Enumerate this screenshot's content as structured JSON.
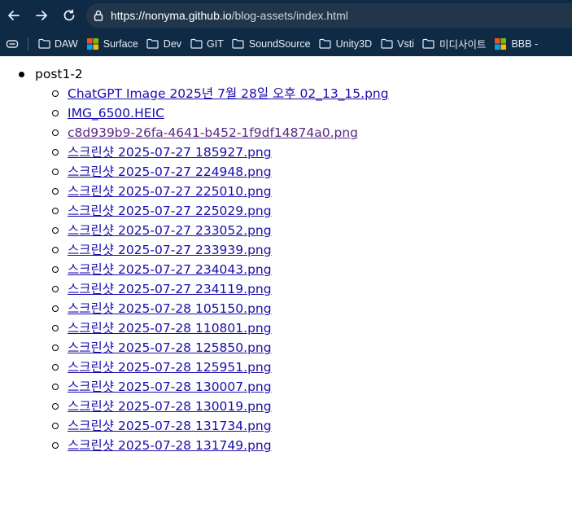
{
  "browser": {
    "url_host": "https://nonyma.github.io",
    "url_path": "/blog-assets/index.html",
    "icons": [
      "back-arrow-icon",
      "forward-arrow-icon",
      "reload-icon",
      "site-info-icon"
    ]
  },
  "bookmarks": [
    {
      "label": "DAW",
      "icon": "folder-icon"
    },
    {
      "label": "Surface",
      "icon": "microsoft-icon"
    },
    {
      "label": "Dev",
      "icon": "folder-icon"
    },
    {
      "label": "GIT",
      "icon": "folder-icon"
    },
    {
      "label": "SoundSource",
      "icon": "folder-icon"
    },
    {
      "label": "Unity3D",
      "icon": "folder-icon"
    },
    {
      "label": "Vsti",
      "icon": "folder-icon"
    },
    {
      "label": "미디사이트",
      "icon": "folder-icon"
    },
    {
      "label": "BBB -",
      "icon": "microsoft-icon"
    }
  ],
  "listing": {
    "folder": "post1-2",
    "files": [
      "ChatGPT Image 2025년 7월 28일 오후 02_13_15.png",
      "IMG_6500.HEIC",
      "c8d939b9-26fa-4641-b452-1f9df14874a0.png",
      "스크린샷 2025-07-27 185927.png",
      "스크린샷 2025-07-27 224948.png",
      "스크린샷 2025-07-27 225010.png",
      "스크린샷 2025-07-27 225029.png",
      "스크린샷 2025-07-27 233052.png",
      "스크린샷 2025-07-27 233939.png",
      "스크린샷 2025-07-27 234043.png",
      "스크린샷 2025-07-27 234119.png",
      "스크린샷 2025-07-28 105150.png",
      "스크린샷 2025-07-28 110801.png",
      "스크린샷 2025-07-28 125850.png",
      "스크린샷 2025-07-28 125951.png",
      "스크린샷 2025-07-28 130007.png",
      "스크린샷 2025-07-28 130019.png",
      "스크린샷 2025-07-28 131734.png",
      "스크린샷 2025-07-28 131749.png"
    ]
  },
  "colors": {
    "chrome_bg": "#0f2a44",
    "link": "#1a0dab",
    "link_visited": "#5a2a84"
  }
}
